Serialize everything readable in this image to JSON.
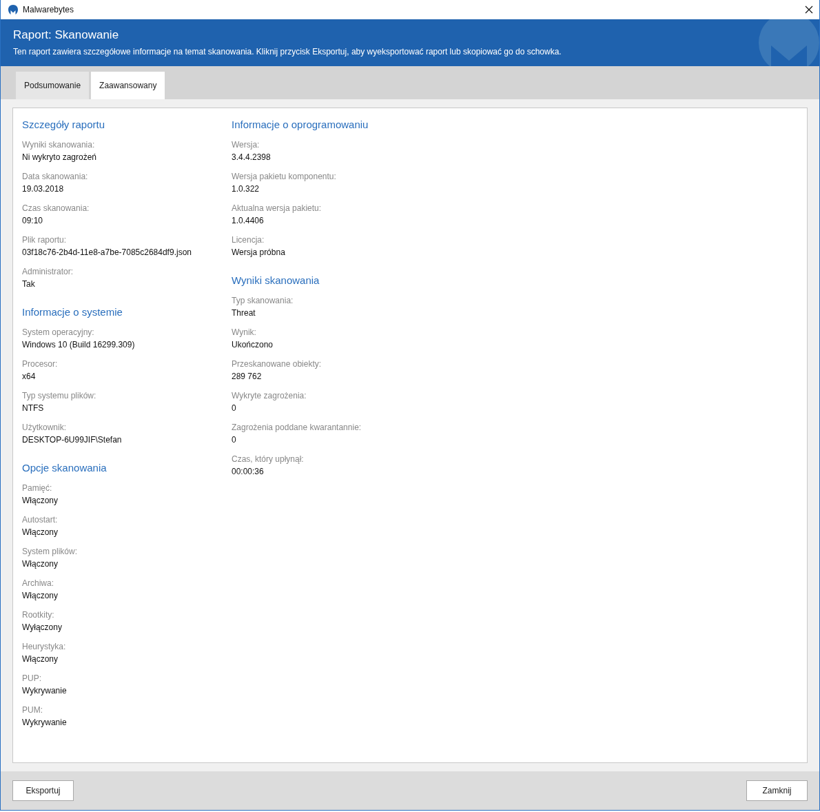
{
  "window": {
    "title": "Malwarebytes"
  },
  "header": {
    "title": "Raport: Skanowanie",
    "description": "Ten raport zawiera szczegółowe informacje na temat skanowania. Kliknij przycisk Eksportuj, aby wyeksportować raport lub skopiować go do schowka."
  },
  "tabs": [
    {
      "label": "Podsumowanie",
      "selected": false
    },
    {
      "label": "Zaawansowany",
      "selected": true
    }
  ],
  "columns": [
    [
      {
        "title": "Szczegóły raportu",
        "fields": [
          {
            "label": "Wyniki skanowania:",
            "value": "Ni wykryto zagrożeń"
          },
          {
            "label": "Data skanowania:",
            "value": "19.03.2018"
          },
          {
            "label": "Czas skanowania:",
            "value": "09:10"
          },
          {
            "label": "Plik raportu:",
            "value": "03f18c76-2b4d-11e8-a7be-7085c2684df9.json"
          },
          {
            "label": "Administrator:",
            "value": "Tak"
          }
        ]
      },
      {
        "title": "Informacje o systemie",
        "fields": [
          {
            "label": "System operacyjny:",
            "value": "Windows 10 (Build 16299.309)"
          },
          {
            "label": "Procesor:",
            "value": "x64"
          },
          {
            "label": "Typ systemu plików:",
            "value": "NTFS"
          },
          {
            "label": "Użytkownik:",
            "value": "DESKTOP-6U99JIF\\Stefan"
          }
        ]
      },
      {
        "title": "Opcje skanowania",
        "fields": [
          {
            "label": "Pamięć:",
            "value": "Włączony"
          },
          {
            "label": "Autostart:",
            "value": "Włączony"
          },
          {
            "label": "System plików:",
            "value": "Włączony"
          },
          {
            "label": "Archiwa:",
            "value": "Włączony"
          },
          {
            "label": "Rootkity:",
            "value": "Wyłączony"
          },
          {
            "label": "Heurystyka:",
            "value": "Włączony"
          },
          {
            "label": "PUP:",
            "value": "Wykrywanie"
          },
          {
            "label": "PUM:",
            "value": "Wykrywanie"
          }
        ]
      }
    ],
    [
      {
        "title": "Informacje o oprogramowaniu",
        "fields": [
          {
            "label": "Wersja:",
            "value": "3.4.4.2398"
          },
          {
            "label": "Wersja pakietu komponentu:",
            "value": "1.0.322"
          },
          {
            "label": "Aktualna wersja pakietu:",
            "value": "1.0.4406"
          },
          {
            "label": "Licencja:",
            "value": "Wersja próbna"
          }
        ]
      },
      {
        "title": "Wyniki skanowania",
        "fields": [
          {
            "label": "Typ skanowania:",
            "value": "Threat"
          },
          {
            "label": "Wynik:",
            "value": "Ukończono"
          },
          {
            "label": "Przeskanowane obiekty:",
            "value": "289 762"
          },
          {
            "label": "Wykryte zagrożenia:",
            "value": "0"
          },
          {
            "label": "Zagrożenia poddane kwarantannie:",
            "value": "0"
          },
          {
            "label": "Czas, który upłynął:",
            "value": "00:00:36"
          }
        ]
      }
    ]
  ],
  "buttons": {
    "left": "Eksportuj",
    "right": "Zamknij"
  }
}
